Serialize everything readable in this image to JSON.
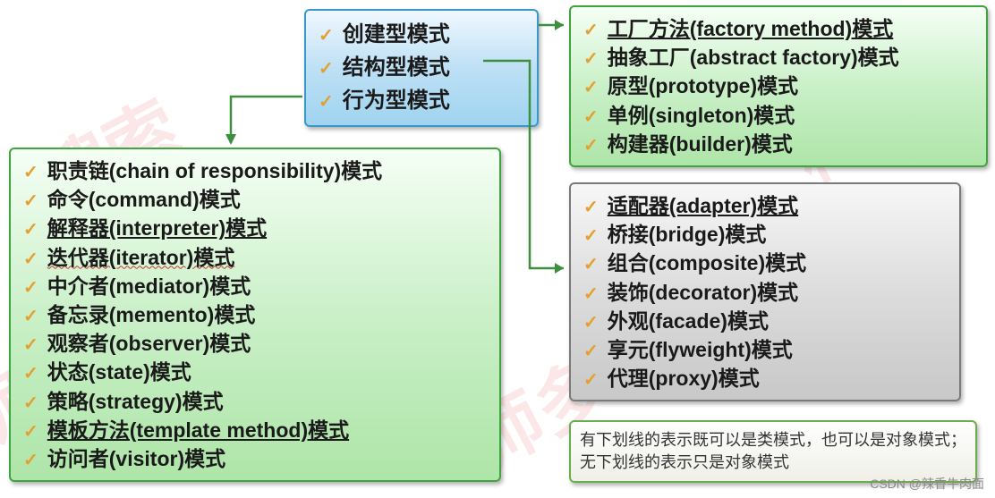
{
  "watermarks": [
    "搜索",
    "构设",
    "师",
    "师多"
  ],
  "center": {
    "items": [
      {
        "label": "创建型模式",
        "underline": false
      },
      {
        "label": "结构型模式",
        "underline": false
      },
      {
        "label": "行为型模式",
        "underline": false
      }
    ]
  },
  "creational": {
    "items": [
      {
        "label": "工厂方法(factory method)模式",
        "underline": true
      },
      {
        "label": "抽象工厂(abstract factory)模式",
        "underline": false
      },
      {
        "label": "原型(prototype)模式",
        "underline": false
      },
      {
        "label": "单例(singleton)模式",
        "underline": false
      },
      {
        "label": "构建器(builder)模式",
        "underline": false
      }
    ]
  },
  "structural": {
    "items": [
      {
        "label": "适配器(adapter)模式",
        "underline": true
      },
      {
        "label": "桥接(bridge)模式",
        "underline": false
      },
      {
        "label": "组合(composite)模式",
        "underline": false
      },
      {
        "label": "装饰(decorator)模式",
        "underline": false
      },
      {
        "label": "外观(facade)模式",
        "underline": false
      },
      {
        "label": "享元(flyweight)模式",
        "underline": false
      },
      {
        "label": "代理(proxy)模式",
        "underline": false
      }
    ]
  },
  "behavioral": {
    "items": [
      {
        "label": "职责链(chain of responsibility)模式",
        "underline": false
      },
      {
        "label": "命令(command)模式",
        "underline": false
      },
      {
        "label": "解释器(interpreter)模式",
        "underline": true
      },
      {
        "label": "迭代器(iterator)模式",
        "underline": false,
        "wavy": true
      },
      {
        "label": "中介者(mediator)模式",
        "underline": false
      },
      {
        "label": "备忘录(memento)模式",
        "underline": false
      },
      {
        "label": "观察者(observer)模式",
        "underline": false
      },
      {
        "label": "状态(state)模式",
        "underline": false
      },
      {
        "label": "策略(strategy)模式",
        "underline": false
      },
      {
        "label": "模板方法(template method)模式",
        "underline": true
      },
      {
        "label": "访问者(visitor)模式",
        "underline": false
      }
    ]
  },
  "note": {
    "text": "有下划线的表示既可以是类模式，也可以是对象模式；无下划线的表示只是对象模式"
  },
  "credit": "CSDN @辣香牛肉面"
}
